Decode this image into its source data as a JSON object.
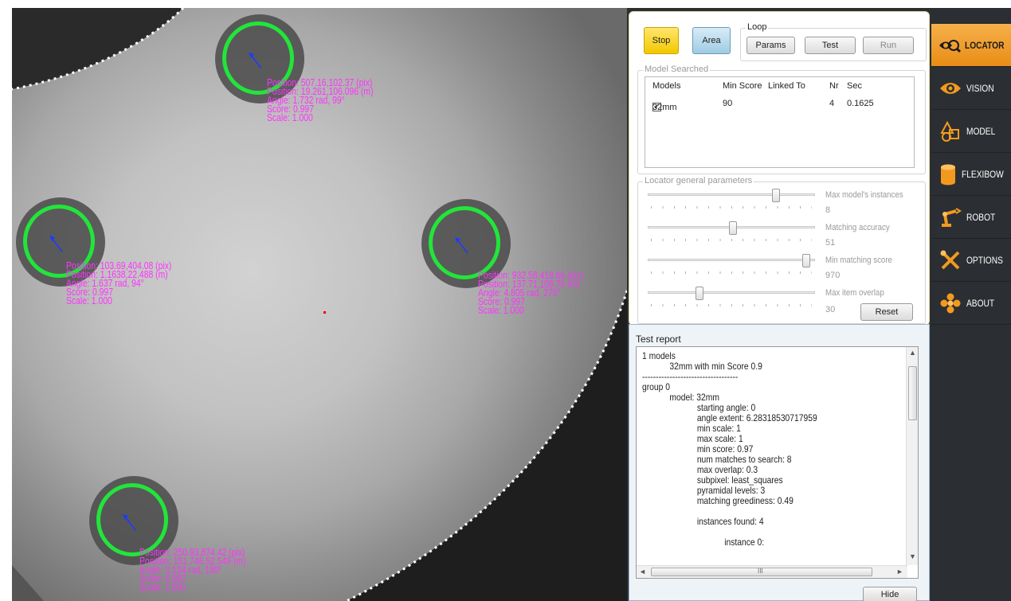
{
  "detections": [
    {
      "position_pix": "Position: 507.16,102.37 (pix)",
      "position_mm": "Position: 19.261,106.096 (m)",
      "angle": "Angle: 1.732 rad, 99°",
      "score": "Score: 0.997",
      "scale": "Scale: 1.000"
    },
    {
      "position_pix": "Position: 103.69,404.08 (pix)",
      "position_mm": "Position: 1.1638,22.488 (m)",
      "angle": "Angle: 1.637 rad, 94°",
      "score": "Score: 0.997",
      "scale": "Scale: 1.000"
    },
    {
      "position_pix": "Position: 932.58,418.66 (pix)",
      "position_mm": "Position: 137.71,108.79 (m)",
      "angle": "Angle: 4.805 rad, 275°",
      "score": "Score: 0.997",
      "scale": "Scale: 1.000"
    },
    {
      "position_pix": "Position: 250.93,874.42 (pix)",
      "position_mm": "Position: 151.746,52.549 (m)",
      "angle": "Angle: 3.134 rad, 180°",
      "score": "Score: 0.997",
      "scale": "Scale: 1.000"
    }
  ],
  "controls": {
    "stop_label": "Stop",
    "area_label": "Area",
    "loop_title": "Loop",
    "params_label": "Params",
    "test_label": "Test",
    "run_label": "Run"
  },
  "model_searched": {
    "title": "Model Searched",
    "columns": [
      "Models",
      "Min Score",
      "Linked To",
      "Nr",
      "Sec"
    ],
    "rows": [
      {
        "checked": "✓",
        "model": "32mm",
        "min_score": "90",
        "linked_to": "",
        "nr": "4",
        "sec": "0.1625"
      }
    ]
  },
  "general_params": {
    "title": "Locator general parameters",
    "sliders": [
      {
        "label": "Max model's instances",
        "value": "8",
        "level": 0.78
      },
      {
        "label": "Matching accuracy",
        "value": "51",
        "level": 0.51
      },
      {
        "label": "Min matching score",
        "value": "970",
        "level": 0.97
      },
      {
        "label": "Max item overlap",
        "value": "30",
        "level": 0.3
      }
    ],
    "reset_label": "Reset"
  },
  "test_report": {
    "title": "Test report",
    "lines": [
      "1 models",
      "            32mm with min Score 0.9",
      "-----------------------------------",
      "group 0",
      "            model: 32mm",
      "                        starting angle: 0",
      "                        angle extent: 6.28318530717959",
      "                        min scale: 1",
      "                        max scale: 1",
      "                        min score: 0.97",
      "                        num matches to search: 8",
      "                        max overlap: 0.3",
      "                        subpixel: least_squares",
      "                        pyramidal levels: 3",
      "                        matching greediness: 0.49",
      "",
      "                        instances found: 4",
      "",
      "                                    instance 0:"
    ],
    "hscroll_mark": "III",
    "hide_label": "Hide"
  },
  "nav": [
    {
      "label": "LOCATOR",
      "icon": "locator-icon",
      "active": true
    },
    {
      "label": "VISION",
      "icon": "eye-icon",
      "active": false
    },
    {
      "label": "MODEL",
      "icon": "shapes-icon",
      "active": false
    },
    {
      "label": "FLEXIBOW",
      "icon": "cylinder-icon",
      "active": false
    },
    {
      "label": "ROBOT",
      "icon": "robot-arm-icon",
      "active": false
    },
    {
      "label": "OPTIONS",
      "icon": "tools-icon",
      "active": false
    },
    {
      "label": "ABOUT",
      "icon": "flower-icon",
      "active": false
    }
  ],
  "colors": {
    "detection_ring": "#22e53a",
    "detection_text": "#ff33ff",
    "nav_active": "#f0a030",
    "stop_button": "#f3c800",
    "area_button": "#9fcbe3"
  }
}
